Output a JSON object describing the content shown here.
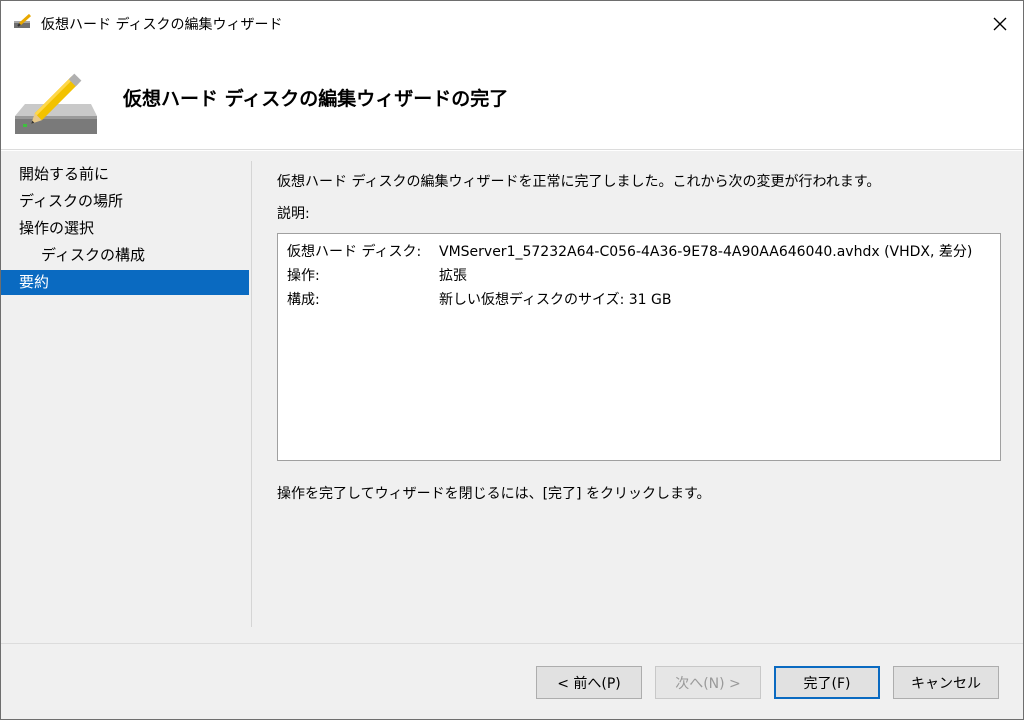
{
  "window": {
    "title": "仮想ハード ディスクの編集ウィザード",
    "header_title": "仮想ハード ディスクの編集ウィザードの完了"
  },
  "nav": {
    "items": [
      {
        "label": "開始する前に"
      },
      {
        "label": "ディスクの場所"
      },
      {
        "label": "操作の選択"
      },
      {
        "label": "ディスクの構成"
      },
      {
        "label": "要約"
      }
    ]
  },
  "content": {
    "intro": "仮想ハード ディスクの編集ウィザードを正常に完了しました。これから次の変更が行われます。",
    "description_label": "説明:",
    "summary": [
      {
        "key": "仮想ハード ディスク:",
        "value": "VMServer1_57232A64-C056-4A36-9E78-4A90AA646040.avhdx (VHDX, 差分)"
      },
      {
        "key": "操作:",
        "value": "拡張"
      },
      {
        "key": "構成:",
        "value": "新しい仮想ディスクのサイズ: 31 GB"
      }
    ],
    "footer": "操作を完了してウィザードを閉じるには、[完了] をクリックします。"
  },
  "buttons": {
    "prev": "< 前へ(P)",
    "next": "次へ(N) >",
    "finish": "完了(F)",
    "cancel": "キャンセル"
  },
  "colors": {
    "accent": "#0a6ac1",
    "background": "#f0f0f0"
  }
}
